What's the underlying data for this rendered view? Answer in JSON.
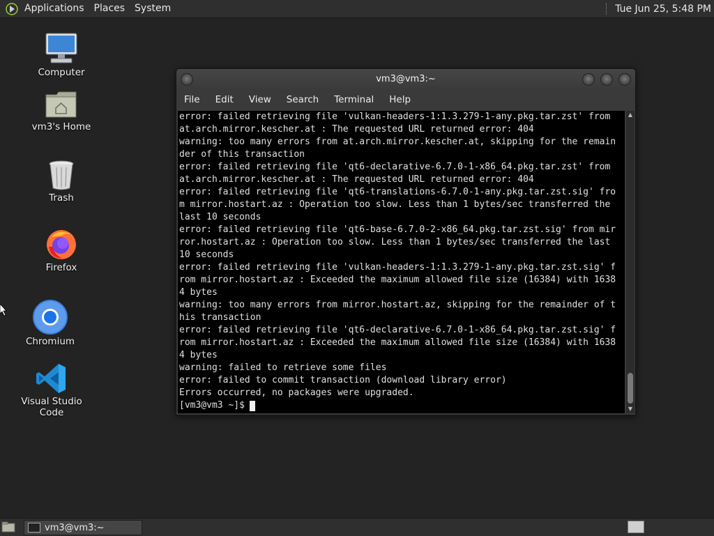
{
  "top_panel": {
    "menus": [
      "Applications",
      "Places",
      "System"
    ],
    "clock": "Tue Jun 25,  5:48 PM"
  },
  "desktop_icons": [
    {
      "label": "Computer",
      "icon": "computer-icon"
    },
    {
      "label": "vm3's Home",
      "icon": "home-folder-icon"
    },
    {
      "label": "Trash",
      "icon": "trash-icon"
    },
    {
      "label": "Firefox",
      "icon": "firefox-icon"
    },
    {
      "label": "Chromium",
      "icon": "chromium-icon"
    },
    {
      "label": "Visual Studio Code",
      "icon": "vscode-icon"
    }
  ],
  "terminal": {
    "title": "vm3@vm3:~",
    "menu": [
      "File",
      "Edit",
      "View",
      "Search",
      "Terminal",
      "Help"
    ],
    "lines": [
      "error: failed retrieving file 'vulkan-headers-1:1.3.279-1-any.pkg.tar.zst' from",
      "at.arch.mirror.kescher.at : The requested URL returned error: 404",
      "warning: too many errors from at.arch.mirror.kescher.at, skipping for the remain",
      "der of this transaction",
      "error: failed retrieving file 'qt6-declarative-6.7.0-1-x86_64.pkg.tar.zst' from",
      "at.arch.mirror.kescher.at : The requested URL returned error: 404",
      "error: failed retrieving file 'qt6-translations-6.7.0-1-any.pkg.tar.zst.sig' fro",
      "m mirror.hostart.az : Operation too slow. Less than 1 bytes/sec transferred the",
      "last 10 seconds",
      "error: failed retrieving file 'qt6-base-6.7.0-2-x86_64.pkg.tar.zst.sig' from mir",
      "ror.hostart.az : Operation too slow. Less than 1 bytes/sec transferred the last",
      "10 seconds",
      "error: failed retrieving file 'vulkan-headers-1:1.3.279-1-any.pkg.tar.zst.sig' f",
      "rom mirror.hostart.az : Exceeded the maximum allowed file size (16384) with 1638",
      "4 bytes",
      "warning: too many errors from mirror.hostart.az, skipping for the remainder of t",
      "his transaction",
      "error: failed retrieving file 'qt6-declarative-6.7.0-1-x86_64.pkg.tar.zst.sig' f",
      "rom mirror.hostart.az : Exceeded the maximum allowed file size (16384) with 1638",
      "4 bytes",
      "warning: failed to retrieve some files",
      "error: failed to commit transaction (download library error)",
      "Errors occurred, no packages were upgraded."
    ],
    "prompt": "[vm3@vm3 ~]$"
  },
  "bottom_panel": {
    "task_label": "vm3@vm3:~"
  }
}
